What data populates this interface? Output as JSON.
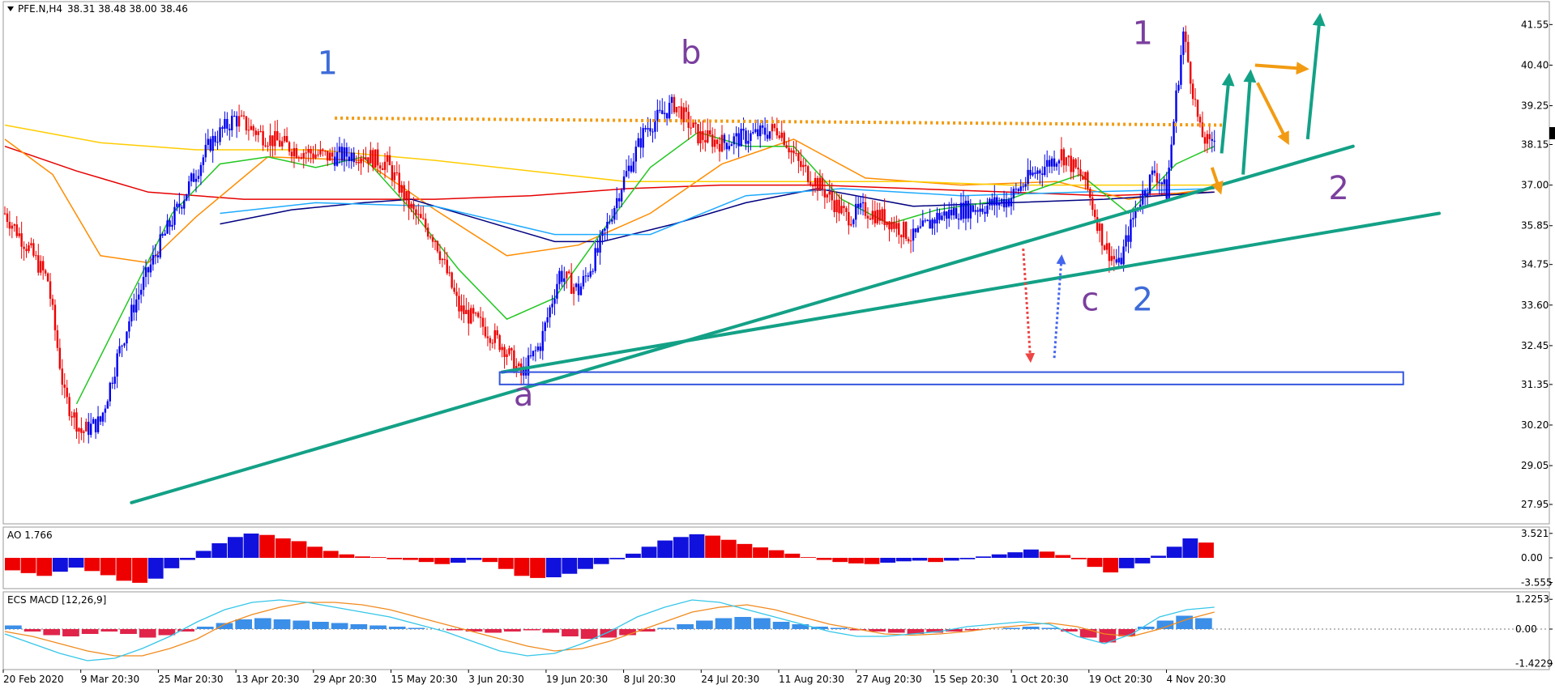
{
  "chart_data": {
    "type": "candlestick",
    "symbol_header": "PFE.N,H4",
    "ohlc_header": "38.31 38.48 38.00 38.46",
    "current_price": "38.46",
    "price_axis": {
      "ylim": [
        27.4,
        42.2
      ],
      "ticks": [
        "41.55",
        "40.40",
        "39.25",
        "38.15",
        "37.00",
        "35.85",
        "34.75",
        "33.60",
        "32.45",
        "31.35",
        "30.20",
        "29.05",
        "27.95"
      ]
    },
    "time_axis": [
      "20 Feb 2020",
      "9 Mar 20:30",
      "25 Mar 20:30",
      "13 Apr 20:30",
      "29 Apr 20:30",
      "15 May 20:30",
      "3 Jun 20:30",
      "19 Jun 20:30",
      "8 Jul 20:30",
      "24 Jul 20:30",
      "11 Aug 20:30",
      "27 Aug 20:30",
      "15 Sep 20:30",
      "1 Oct 20:30",
      "19 Oct 20:30",
      "4 Nov 20:30"
    ],
    "price_path": [
      [
        0,
        36.2
      ],
      [
        10,
        35.2
      ],
      [
        18,
        34.3
      ],
      [
        25,
        31.0
      ],
      [
        32,
        30.0
      ],
      [
        40,
        30.3
      ],
      [
        47,
        32.1
      ],
      [
        54,
        33.6
      ],
      [
        64,
        35.2
      ],
      [
        75,
        36.7
      ],
      [
        86,
        38.2
      ],
      [
        96,
        38.9
      ],
      [
        108,
        38.4
      ],
      [
        122,
        38.0
      ],
      [
        136,
        37.8
      ],
      [
        149,
        37.9
      ],
      [
        160,
        37.6
      ],
      [
        171,
        36.2
      ],
      [
        180,
        35.5
      ],
      [
        190,
        33.5
      ],
      [
        200,
        33.0
      ],
      [
        209,
        32.4
      ],
      [
        216,
        31.6
      ],
      [
        224,
        32.5
      ],
      [
        232,
        34.5
      ],
      [
        240,
        34.0
      ],
      [
        248,
        35.1
      ],
      [
        258,
        37.0
      ],
      [
        268,
        38.6
      ],
      [
        280,
        39.3
      ],
      [
        290,
        38.4
      ],
      [
        300,
        38.2
      ],
      [
        312,
        38.4
      ],
      [
        324,
        38.6
      ],
      [
        332,
        37.6
      ],
      [
        342,
        36.9
      ],
      [
        352,
        36.1
      ],
      [
        360,
        36.3
      ],
      [
        370,
        36.0
      ],
      [
        380,
        35.5
      ],
      [
        390,
        36.1
      ],
      [
        400,
        36.3
      ],
      [
        410,
        36.4
      ],
      [
        420,
        36.6
      ],
      [
        430,
        37.3
      ],
      [
        442,
        37.9
      ],
      [
        452,
        37.1
      ],
      [
        460,
        35.3
      ],
      [
        466,
        34.7
      ],
      [
        474,
        36.5
      ],
      [
        481,
        37.4
      ],
      [
        486,
        36.8
      ],
      [
        490,
        39.5
      ],
      [
        493,
        41.3
      ],
      [
        496,
        40.1
      ],
      [
        500,
        38.5
      ],
      [
        504,
        38.1
      ],
      [
        506,
        38.46
      ]
    ],
    "trend_lines": [
      {
        "from": [
          53,
          28.0
        ],
        "to": [
          564,
          38.1
        ]
      },
      {
        "from": [
          208,
          31.7
        ],
        "to": [
          600,
          36.2
        ]
      }
    ],
    "resistance_line": {
      "from": [
        138,
        38.9
      ],
      "to": [
        510,
        38.7
      ]
    },
    "support_zone": {
      "from_x": 207,
      "to_x": 585,
      "low": 31.35,
      "high": 31.7
    },
    "wave_labels": [
      {
        "text": "1",
        "x": 135,
        "y": 40.15,
        "color": "#3d6bd9"
      },
      {
        "text": "a",
        "x": 217,
        "y": 30.75,
        "color": "#7b3f9e"
      },
      {
        "text": "b",
        "x": 287,
        "y": 40.45,
        "color": "#7b3f9e"
      },
      {
        "text": "c",
        "x": 454,
        "y": 33.45,
        "color": "#7b3f9e"
      },
      {
        "text": "2",
        "x": 476,
        "y": 33.45,
        "color": "#3d6bd9"
      },
      {
        "text": "1",
        "x": 476,
        "y": 41.0,
        "color": "#7b3f9e"
      },
      {
        "text": "2",
        "x": 558,
        "y": 36.6,
        "color": "#7b3f9e"
      }
    ],
    "ma_series": [
      {
        "color": "#e60000",
        "points": [
          [
            0,
            38.1
          ],
          [
            30,
            37.4
          ],
          [
            60,
            36.8
          ],
          [
            100,
            36.6
          ],
          [
            140,
            36.6
          ],
          [
            180,
            36.6
          ],
          [
            220,
            36.7
          ],
          [
            260,
            36.9
          ],
          [
            300,
            37.0
          ],
          [
            340,
            37.0
          ],
          [
            380,
            36.9
          ],
          [
            420,
            36.8
          ],
          [
            460,
            36.7
          ],
          [
            506,
            36.8
          ]
        ]
      },
      {
        "color": "#ff8c00",
        "points": [
          [
            0,
            38.3
          ],
          [
            20,
            37.3
          ],
          [
            40,
            35.0
          ],
          [
            60,
            34.8
          ],
          [
            80,
            36.1
          ],
          [
            110,
            37.8
          ],
          [
            150,
            37.7
          ],
          [
            180,
            36.3
          ],
          [
            210,
            35.0
          ],
          [
            240,
            35.3
          ],
          [
            270,
            36.2
          ],
          [
            300,
            37.6
          ],
          [
            330,
            38.3
          ],
          [
            360,
            37.2
          ],
          [
            400,
            37.0
          ],
          [
            440,
            37.1
          ],
          [
            470,
            36.6
          ],
          [
            506,
            36.9
          ]
        ]
      },
      {
        "color": "#ffcc00",
        "points": [
          [
            0,
            38.7
          ],
          [
            40,
            38.2
          ],
          [
            80,
            38.0
          ],
          [
            130,
            38.0
          ],
          [
            180,
            37.7
          ],
          [
            220,
            37.4
          ],
          [
            260,
            37.1
          ],
          [
            300,
            37.1
          ],
          [
            340,
            37.1
          ],
          [
            380,
            37.1
          ],
          [
            420,
            37.0
          ],
          [
            460,
            37.0
          ],
          [
            506,
            37.0
          ]
        ]
      },
      {
        "color": "#000080",
        "points": [
          [
            90,
            35.9
          ],
          [
            120,
            36.3
          ],
          [
            150,
            36.5
          ],
          [
            170,
            36.6
          ],
          [
            200,
            36.0
          ],
          [
            230,
            35.4
          ],
          [
            250,
            35.4
          ],
          [
            280,
            35.9
          ],
          [
            310,
            36.5
          ],
          [
            340,
            36.9
          ],
          [
            380,
            36.4
          ],
          [
            420,
            36.5
          ],
          [
            460,
            36.6
          ],
          [
            506,
            36.8
          ]
        ]
      },
      {
        "color": "#1eaaff",
        "points": [
          [
            90,
            36.2
          ],
          [
            130,
            36.5
          ],
          [
            180,
            36.4
          ],
          [
            230,
            35.6
          ],
          [
            270,
            35.6
          ],
          [
            310,
            36.7
          ],
          [
            350,
            36.9
          ],
          [
            400,
            36.7
          ],
          [
            450,
            36.8
          ],
          [
            506,
            36.9
          ]
        ]
      },
      {
        "color": "#22c722",
        "points": [
          [
            30,
            30.8
          ],
          [
            50,
            33.5
          ],
          [
            70,
            36.2
          ],
          [
            90,
            37.6
          ],
          [
            110,
            37.8
          ],
          [
            130,
            37.5
          ],
          [
            150,
            37.8
          ],
          [
            170,
            36.3
          ],
          [
            190,
            34.6
          ],
          [
            210,
            33.2
          ],
          [
            230,
            33.8
          ],
          [
            250,
            35.7
          ],
          [
            270,
            37.5
          ],
          [
            290,
            38.5
          ],
          [
            310,
            38.1
          ],
          [
            330,
            38.1
          ],
          [
            350,
            36.6
          ],
          [
            370,
            35.9
          ],
          [
            390,
            36.3
          ],
          [
            420,
            36.6
          ],
          [
            450,
            37.3
          ],
          [
            470,
            36.2
          ],
          [
            490,
            37.6
          ],
          [
            506,
            38.1
          ]
        ]
      }
    ],
    "ao": {
      "label": "AO 1.766",
      "ticks": [
        "3.521",
        "0.00",
        "-3.555"
      ],
      "ylim": [
        -4.2,
        4.2
      ],
      "values": [
        -1.8,
        -2.2,
        -2.6,
        -2.0,
        -1.4,
        -1.9,
        -2.5,
        -3.3,
        -3.6,
        -3.0,
        -1.5,
        -0.3,
        1.0,
        2.1,
        3.0,
        3.5,
        3.3,
        2.8,
        2.4,
        1.6,
        1.0,
        0.5,
        0.2,
        0.1,
        -0.2,
        -0.3,
        -0.6,
        -0.9,
        -0.7,
        -0.3,
        -0.6,
        -1.6,
        -2.6,
        -2.9,
        -2.8,
        -2.3,
        -1.6,
        -0.9,
        -0.2,
        0.6,
        1.6,
        2.5,
        3.0,
        3.4,
        3.2,
        2.6,
        2.0,
        1.5,
        1.1,
        0.6,
        0.1,
        -0.3,
        -0.6,
        -0.8,
        -0.9,
        -0.7,
        -0.5,
        -0.4,
        -0.6,
        -0.4,
        -0.2,
        0.2,
        0.5,
        0.8,
        1.2,
        0.9,
        0.4,
        -0.2,
        -1.3,
        -2.1,
        -1.5,
        -0.8,
        0.3,
        1.6,
        2.8,
        2.2
      ]
    },
    "macd": {
      "label": "ECS MACD [12,26,9]",
      "ticks": [
        "1.2253",
        "0.00",
        "-1.4229"
      ],
      "ylim": [
        -1.6,
        1.4
      ],
      "histogram": [
        0.15,
        -0.1,
        -0.25,
        -0.3,
        -0.2,
        -0.1,
        -0.2,
        -0.35,
        -0.25,
        -0.1,
        0.1,
        0.25,
        0.4,
        0.45,
        0.4,
        0.35,
        0.3,
        0.25,
        0.2,
        0.15,
        0.1,
        0.05,
        0.0,
        -0.05,
        -0.1,
        -0.15,
        -0.1,
        -0.05,
        -0.15,
        -0.3,
        -0.4,
        -0.35,
        -0.25,
        -0.1,
        0.05,
        0.2,
        0.35,
        0.45,
        0.5,
        0.45,
        0.3,
        0.2,
        0.1,
        0.05,
        -0.05,
        -0.1,
        -0.15,
        -0.2,
        -0.15,
        -0.1,
        -0.05,
        0.0,
        0.05,
        0.1,
        0.05,
        -0.1,
        -0.35,
        -0.55,
        -0.3,
        0.1,
        0.35,
        0.55,
        0.45
      ],
      "macd_line": [
        -0.2,
        -0.6,
        -1.0,
        -1.3,
        -1.2,
        -0.8,
        -0.3,
        0.3,
        0.8,
        1.1,
        1.2,
        1.1,
        0.9,
        0.7,
        0.5,
        0.2,
        -0.1,
        -0.5,
        -0.9,
        -1.1,
        -1.0,
        -0.6,
        -0.1,
        0.5,
        0.9,
        1.2,
        1.1,
        0.8,
        0.5,
        0.2,
        -0.1,
        -0.3,
        -0.3,
        -0.2,
        -0.1,
        0.1,
        0.2,
        0.3,
        0.2,
        -0.3,
        -0.6,
        -0.2,
        0.5,
        0.8,
        0.9
      ],
      "signal_line": [
        -0.1,
        -0.3,
        -0.6,
        -0.9,
        -1.1,
        -1.1,
        -0.8,
        -0.4,
        0.2,
        0.6,
        0.9,
        1.1,
        1.1,
        1.0,
        0.8,
        0.5,
        0.2,
        -0.1,
        -0.4,
        -0.7,
        -0.9,
        -0.8,
        -0.5,
        -0.1,
        0.3,
        0.7,
        0.9,
        1.0,
        0.8,
        0.5,
        0.2,
        0.0,
        -0.2,
        -0.25,
        -0.2,
        -0.1,
        0.05,
        0.15,
        0.25,
        0.1,
        -0.2,
        -0.3,
        0.0,
        0.4,
        0.7
      ]
    }
  }
}
